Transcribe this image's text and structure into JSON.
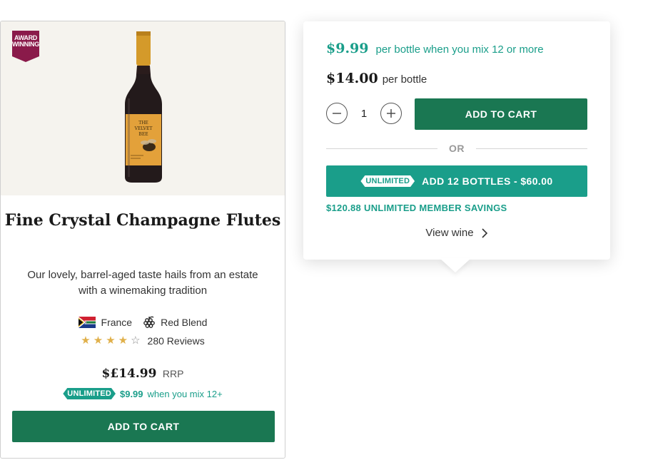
{
  "card": {
    "badge_line1": "AWARD",
    "badge_line2": "WINNING",
    "bottle_label_line1": "THE",
    "bottle_label_line2": "VELVET",
    "bottle_label_line3": "BEE",
    "title": "Fine Crystal Champagne Flutes",
    "description": "Our lovely, barrel-aged taste hails from an estate with a winemaking tradition",
    "country": "France",
    "grape": "Red Blend",
    "rating": 4,
    "rating_max": 5,
    "reviews": "280 Reviews",
    "price": "$£14.99",
    "rrp": "RRP",
    "unlimited_tag": "UNLIMITED",
    "promo_price": "$9.99",
    "promo_text": "when you mix 12+",
    "cta": "ADD TO CART"
  },
  "popover": {
    "mix_price": "$9.99",
    "mix_text": "per bottle when you mix 12 or more",
    "bottle_price": "$14.00",
    "bottle_text": "per bottle",
    "quantity": "1",
    "add_to_cart": "ADD TO CART",
    "or": "OR",
    "unlimited_tag": "UNLIMITED",
    "bundle_label": "ADD 12 BOTTLES - $60.00",
    "savings": "$120.88 UNLIMITED MEMBER SAVINGS",
    "view_wine": "View wine"
  },
  "colors": {
    "primary_green": "#1a7752",
    "teal": "#1a9e8a",
    "badge_maroon": "#8a1a4a",
    "star_gold": "#e0b04a"
  },
  "icons": [
    "award-badge-icon",
    "south-africa-flag-icon",
    "grape-icon",
    "star-icon",
    "minus-icon",
    "plus-icon",
    "chevron-right-icon"
  ]
}
